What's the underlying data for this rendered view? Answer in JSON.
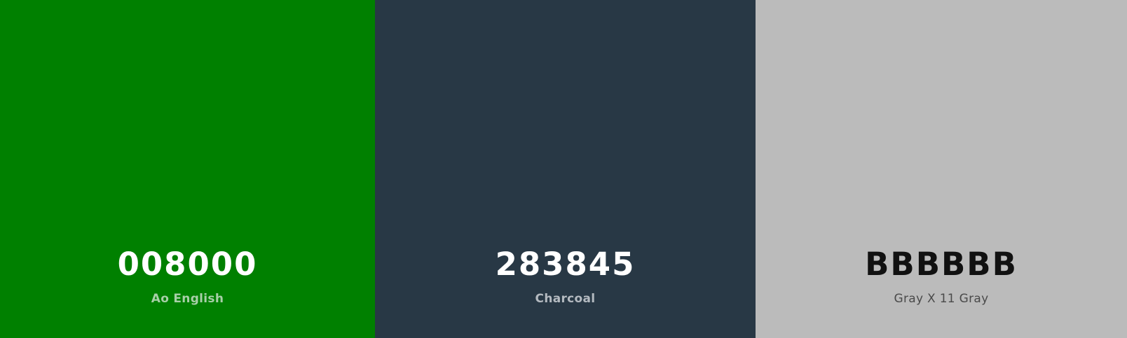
{
  "swatches": [
    {
      "hex": "008000",
      "name": "Ao English",
      "background": "#008000",
      "hex_color": "#ffffff",
      "name_color": "#a8cfa8"
    },
    {
      "hex": "283845",
      "name": "Charcoal",
      "background": "#283845",
      "hex_color": "#ffffff",
      "name_color": "#b4bac0"
    },
    {
      "hex": "BBBBBB",
      "name": "Gray X 11 Gray",
      "background": "#bbbbbb",
      "hex_color": "#111111",
      "name_color": "#4a4a4a"
    }
  ]
}
